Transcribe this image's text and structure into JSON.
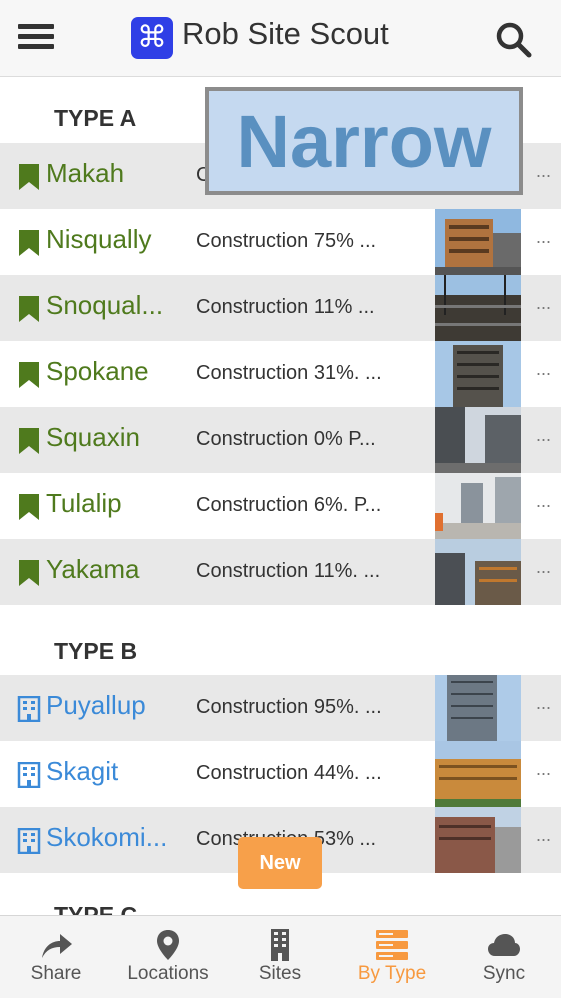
{
  "header": {
    "title": "Rob Site Scout"
  },
  "overlay": {
    "narrow_label": "Narrow",
    "new_label": "New"
  },
  "sections": [
    {
      "title": "TYPE A",
      "rows": [
        {
          "name": "Makah",
          "desc": "C"
        },
        {
          "name": "Nisqually",
          "desc": "Construction 75% ..."
        },
        {
          "name": "Snoqual...",
          "desc": "Construction 11% ..."
        },
        {
          "name": "Spokane",
          "desc": "Construction 31%. ..."
        },
        {
          "name": "Squaxin",
          "desc": "Construction 0% P..."
        },
        {
          "name": "Tulalip",
          "desc": "Construction 6%. P..."
        },
        {
          "name": "Yakama",
          "desc": "Construction 11%. ..."
        }
      ]
    },
    {
      "title": "TYPE B",
      "rows": [
        {
          "name": "Puyallup",
          "desc": "Construction 95%. ..."
        },
        {
          "name": "Skagit",
          "desc": "Construction 44%. ..."
        },
        {
          "name": "Skokomi...",
          "desc": "Construction 53% ..."
        }
      ]
    },
    {
      "title": "TYPE C"
    }
  ],
  "row_more": "...",
  "tabs": [
    {
      "label": "Share",
      "icon": "share-icon"
    },
    {
      "label": "Locations",
      "icon": "location-pin-icon"
    },
    {
      "label": "Sites",
      "icon": "building-icon"
    },
    {
      "label": "By Type",
      "icon": "server-stack-icon",
      "active": true
    },
    {
      "label": "Sync",
      "icon": "cloud-icon"
    }
  ],
  "colors": {
    "type_a_name": "#4f7a1d",
    "type_b_name": "#3b8ad8",
    "active_tab": "#f7993f",
    "logo": "#2f3fe6"
  }
}
